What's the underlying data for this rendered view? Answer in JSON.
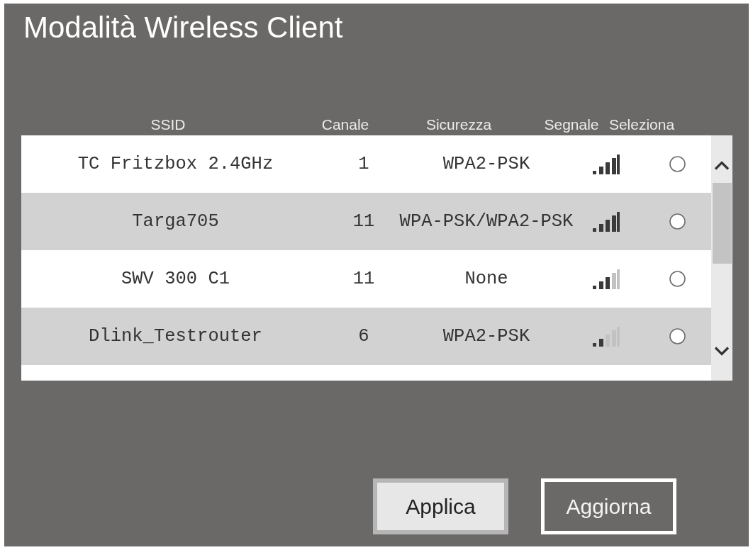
{
  "window": {
    "title": "Modalità Wireless Client"
  },
  "table": {
    "columns": [
      "SSID",
      "Canale",
      "Sicurezza",
      "Segnale",
      "Seleziona"
    ],
    "rows": [
      {
        "ssid": "TC Fritzbox 2.4GHz",
        "channel": "1",
        "security": "WPA2-PSK",
        "kind": "strong",
        "selected": false
      },
      {
        "ssid": "Targa705",
        "channel": "11",
        "security": "WPA-PSK/WPA2-PSK",
        "kind": "strong",
        "selected": false
      },
      {
        "ssid": "SWV 300 C1",
        "channel": "11",
        "security": "None",
        "kind": "medium",
        "selected": false
      },
      {
        "ssid": "Dlink_Testrouter",
        "channel": "6",
        "security": "WPA2-PSK",
        "kind": "weak",
        "selected": false
      }
    ]
  },
  "buttons": [
    {
      "label": "Applica",
      "kind": "filled"
    },
    {
      "label": "Aggiorna",
      "kind": "outline"
    }
  ]
}
